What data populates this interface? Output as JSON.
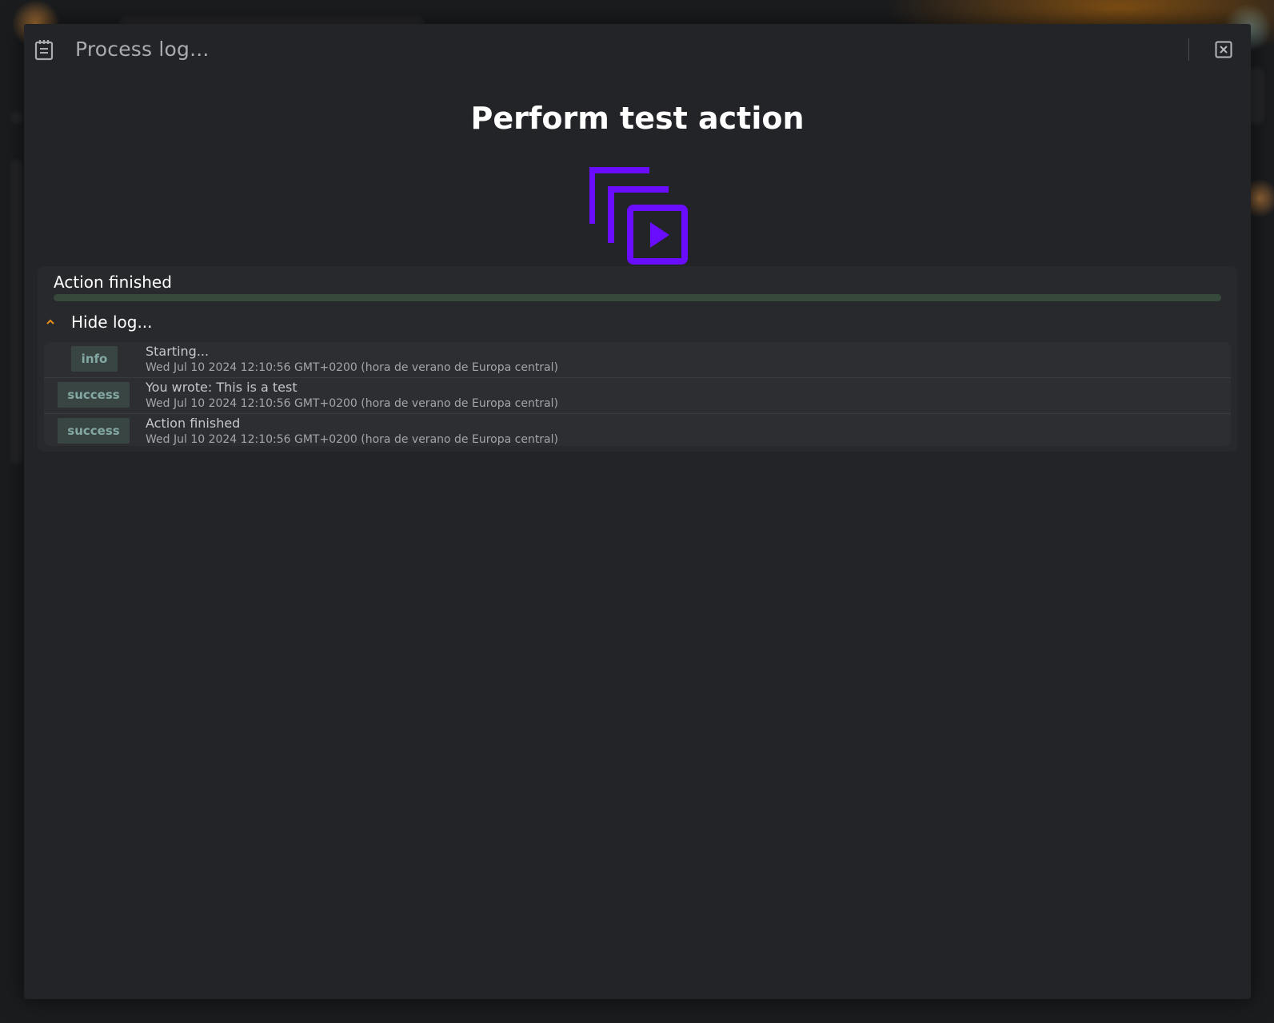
{
  "dialog": {
    "title": "Process log...",
    "heading": "Perform test action",
    "icons": {
      "title": "log-notepad-icon",
      "close": "close-box-icon",
      "hero": "run-action-icon"
    },
    "colors": {
      "accent": "#6a0dff",
      "chevron": "#e8901a",
      "progress": "#37493a",
      "badge_bg": "#394543",
      "badge_text": "#84a8a3"
    }
  },
  "status": {
    "text": "Action finished",
    "progress_percent": 100,
    "toggle_label": "Hide log..."
  },
  "log": [
    {
      "level": "info",
      "message": "Starting...",
      "time": "Wed Jul 10 2024 12:10:56 GMT+0200 (hora de verano de Europa central)"
    },
    {
      "level": "success",
      "message": "You wrote: This is a test",
      "time": "Wed Jul 10 2024 12:10:56 GMT+0200 (hora de verano de Europa central)"
    },
    {
      "level": "success",
      "message": "Action finished",
      "time": "Wed Jul 10 2024 12:10:56 GMT+0200 (hora de verano de Europa central)"
    }
  ]
}
